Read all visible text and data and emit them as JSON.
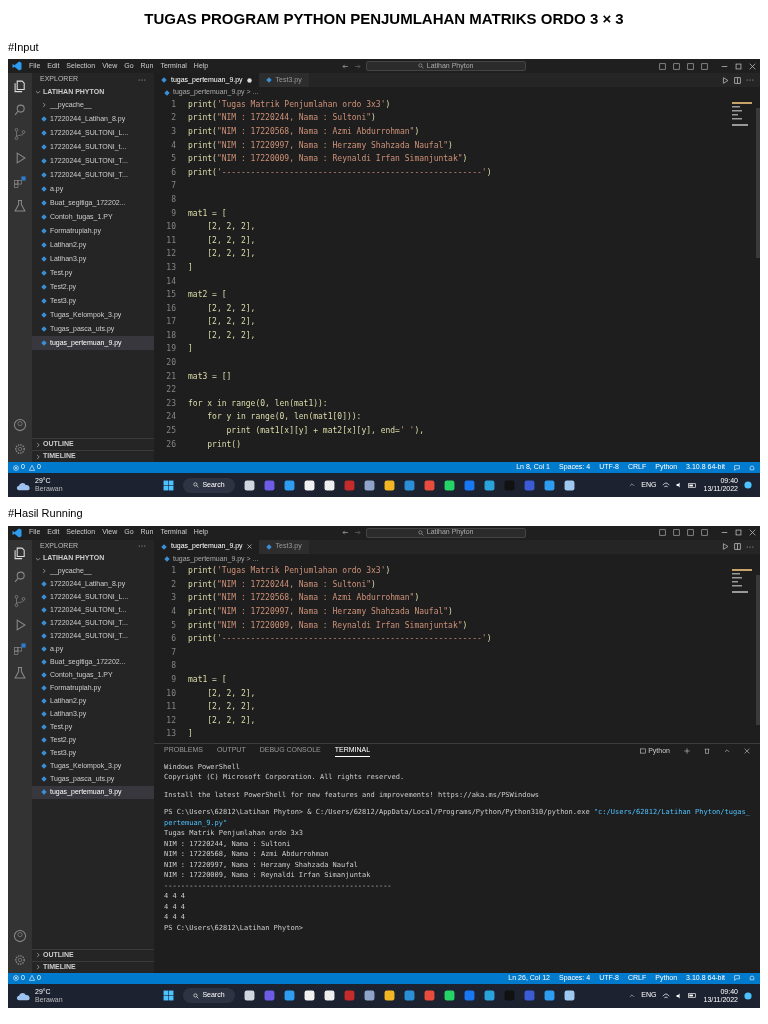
{
  "heading": "TUGAS PROGRAM PYTHON PENJUMLAHAN MATRIKS ORDO 3 × 3",
  "sections": [
    {
      "label": "#Input",
      "screenshot": {
        "menu": [
          "File",
          "Edit",
          "Selection",
          "View",
          "Go",
          "Run",
          "Terminal",
          "Help"
        ],
        "search": "Latihan Phyton",
        "sidebar": {
          "title": "EXPLORER",
          "folder": "LATIHAN PHYTON",
          "items": [
            {
              "label": "__pycache__",
              "kind": "folder",
              "selected": false
            },
            {
              "label": "17220244_Latihan_8.py",
              "kind": "file",
              "selected": false
            },
            {
              "label": "17220244_SULTONI_L...",
              "kind": "file",
              "selected": false
            },
            {
              "label": "17220244_SULTONI_t...",
              "kind": "file",
              "selected": false
            },
            {
              "label": "17220244_SULTONI_T...",
              "kind": "file",
              "selected": false
            },
            {
              "label": "17220244_SULTONI_T...",
              "kind": "file",
              "selected": false
            },
            {
              "label": "a.py",
              "kind": "file",
              "selected": false
            },
            {
              "label": "Buat_segitiga_172202...",
              "kind": "file",
              "selected": false
            },
            {
              "label": "Contoh_tugas_1.PY",
              "kind": "file",
              "selected": false
            },
            {
              "label": "Formatrupiah.py",
              "kind": "file",
              "selected": false
            },
            {
              "label": "Latihan2.py",
              "kind": "file",
              "selected": false
            },
            {
              "label": "Latihan3.py",
              "kind": "file",
              "selected": false
            },
            {
              "label": "Test.py",
              "kind": "file",
              "selected": false
            },
            {
              "label": "Test2.py",
              "kind": "file",
              "selected": false
            },
            {
              "label": "Test3.py",
              "kind": "file",
              "selected": false
            },
            {
              "label": "Tugas_Kelompok_3.py",
              "kind": "file",
              "selected": false
            },
            {
              "label": "Tugas_pasca_uts.py",
              "kind": "file",
              "selected": false
            },
            {
              "label": "tugas_pertemuan_9.py",
              "kind": "file",
              "selected": true
            }
          ],
          "bottom": [
            "OUTLINE",
            "TIMELINE"
          ]
        },
        "tabs": [
          {
            "label": "tugas_pertemuan_9.py",
            "selected": true,
            "modified": true
          },
          {
            "label": "Test3.py",
            "selected": false,
            "modified": false
          }
        ],
        "breadcrumb": "tugas_pertemuan_9.py > ...",
        "code": [
          {
            "n": "1",
            "code": "print('Tugas Matrik Penjumlahan ordo 3x3')"
          },
          {
            "n": "2",
            "code": "print(\"NIM : 17220244, Nama : Sultoni\")"
          },
          {
            "n": "3",
            "code": "print(\"NIM : 17220568, Nama : Azmi Abdurrohman\")"
          },
          {
            "n": "4",
            "code": "print(\"NIM : 17220997, Nama : Herzamy Shahzada Naufal\")"
          },
          {
            "n": "5",
            "code": "print(\"NIM : 17220009, Nama : Reynaldi Irfan Simanjuntak\")"
          },
          {
            "n": "6",
            "code": "print('------------------------------------------------------')"
          },
          {
            "n": "7"
          },
          {
            "n": "8"
          },
          {
            "n": "9",
            "code": "mat1 = ["
          },
          {
            "n": "10",
            "code": "    [2, 2, 2],"
          },
          {
            "n": "11",
            "code": "    [2, 2, 2],"
          },
          {
            "n": "12",
            "code": "    [2, 2, 2],"
          },
          {
            "n": "13",
            "code": "]"
          },
          {
            "n": "14"
          },
          {
            "n": "15",
            "code": "mat2 = ["
          },
          {
            "n": "16",
            "code": "    [2, 2, 2],"
          },
          {
            "n": "17",
            "code": "    [2, 2, 2],"
          },
          {
            "n": "18",
            "code": "    [2, 2, 2],"
          },
          {
            "n": "19",
            "code": "]"
          },
          {
            "n": "20"
          },
          {
            "n": "21",
            "code": "mat3 = []"
          },
          {
            "n": "22"
          },
          {
            "n": "23",
            "code": "for x in range(0, len(mat1)):"
          },
          {
            "n": "24",
            "code": "    for y in range(0, len(mat1[0])):"
          },
          {
            "n": "25",
            "code": "        print (mat1[x][y] + mat2[x][y], end=' '),"
          },
          {
            "n": "26",
            "code": "    print()"
          }
        ],
        "status": {
          "errors": "0",
          "warnings": "0",
          "items": [
            "Ln 8, Col 1",
            "Spaces: 4",
            "UTF-8",
            "CRLF",
            "Python",
            "3.10.8 64-bit"
          ]
        },
        "taskbar": {
          "temperature": "29°C",
          "weather": "Berawan",
          "search": "Search",
          "language": "ENG",
          "time": "09:40",
          "date": "13/11/2022"
        }
      }
    },
    {
      "label": "#Hasil Running",
      "screenshot": {
        "menu": [
          "File",
          "Edit",
          "Selection",
          "View",
          "Go",
          "Run",
          "Terminal",
          "Help"
        ],
        "search": "Latihan Phyton",
        "sidebar": {
          "title": "EXPLORER",
          "folder": "LATIHAN PHYTON",
          "items": [
            {
              "label": "__pycache__",
              "kind": "folder",
              "selected": false
            },
            {
              "label": "17220244_Latihan_8.py",
              "kind": "file",
              "selected": false
            },
            {
              "label": "17220244_SULTONI_L...",
              "kind": "file",
              "selected": false
            },
            {
              "label": "17220244_SULTONI_t...",
              "kind": "file",
              "selected": false
            },
            {
              "label": "17220244_SULTONI_T...",
              "kind": "file",
              "selected": false
            },
            {
              "label": "17220244_SULTONI_T...",
              "kind": "file",
              "selected": false
            },
            {
              "label": "a.py",
              "kind": "file",
              "selected": false
            },
            {
              "label": "Buat_segitiga_172202...",
              "kind": "file",
              "selected": false
            },
            {
              "label": "Contoh_tugas_1.PY",
              "kind": "file",
              "selected": false
            },
            {
              "label": "Formatrupiah.py",
              "kind": "file",
              "selected": false
            },
            {
              "label": "Latihan2.py",
              "kind": "file",
              "selected": false
            },
            {
              "label": "Latihan3.py",
              "kind": "file",
              "selected": false
            },
            {
              "label": "Test.py",
              "kind": "file",
              "selected": false
            },
            {
              "label": "Test2.py",
              "kind": "file",
              "selected": false
            },
            {
              "label": "Test3.py",
              "kind": "file",
              "selected": false
            },
            {
              "label": "Tugas_Kelompok_3.py",
              "kind": "file",
              "selected": false
            },
            {
              "label": "Tugas_pasca_uts.py",
              "kind": "file",
              "selected": false
            },
            {
              "label": "tugas_pertemuan_9.py",
              "kind": "file",
              "selected": true
            }
          ],
          "bottom": [
            "OUTLINE",
            "TIMELINE"
          ]
        },
        "tabs": [
          {
            "label": "tugas_pertemuan_9.py",
            "selected": true,
            "modified": false
          },
          {
            "label": "Test3.py",
            "selected": false,
            "modified": false
          }
        ],
        "breadcrumb": "tugas_pertemuan_9.py > ...",
        "code": [
          {
            "n": "1",
            "code": "print('Tugas Matrik Penjumlahan ordo 3x3')"
          },
          {
            "n": "2",
            "code": "print(\"NIM : 17220244, Nama : Sultoni\")"
          },
          {
            "n": "3",
            "code": "print(\"NIM : 17220568, Nama : Azmi Abdurrohman\")"
          },
          {
            "n": "4",
            "code": "print(\"NIM : 17220997, Nama : Herzamy Shahzada Naufal\")"
          },
          {
            "n": "5",
            "code": "print(\"NIM : 17220009, Nama : Reynaldi Irfan Simanjuntak\")"
          },
          {
            "n": "6",
            "code": "print('------------------------------------------------------')"
          },
          {
            "n": "7"
          },
          {
            "n": "8"
          },
          {
            "n": "9",
            "code": "mat1 = ["
          },
          {
            "n": "10",
            "code": "    [2, 2, 2],"
          },
          {
            "n": "11",
            "code": "    [2, 2, 2],"
          },
          {
            "n": "12",
            "code": "    [2, 2, 2],"
          },
          {
            "n": "13",
            "code": "]"
          }
        ],
        "panel": {
          "tabs": [
            {
              "label": "PROBLEMS",
              "selected": false
            },
            {
              "label": "OUTPUT",
              "selected": false
            },
            {
              "label": "DEBUG CONSOLE",
              "selected": false
            },
            {
              "label": "TERMINAL",
              "selected": true
            }
          ],
          "shell": "Python",
          "blocks": [
            [
              "Windows PowerShell",
              "Copyright (C) Microsoft Corporation. All rights reserved."
            ],
            [
              "Install the latest PowerShell for new features and improvements! https://aka.ms/PSWindows"
            ],
            [
              "PS C:\\Users\\62812\\Latihan Phyton> & C:/Users/62812/AppData/Local/Programs/Python/Python310/python.exe \"c:/Users/62812/Latihan Phyton/tugas_pertemuan_9.py\"",
              "Tugas Matrik Penjumlahan ordo 3x3",
              "NIM : 17220244, Nama : Sultoni",
              "NIM : 17220568, Nama : Azmi Abdurrohman",
              "NIM : 17220997, Nama : Herzamy Shahzada Naufal",
              "NIM : 17220009, Nama : Reynaldi Irfan Simanjuntak",
              "------------------------------------------------------",
              "4 4 4",
              "4 4 4",
              "4 4 4",
              "PS C:\\Users\\62812\\Latihan Phyton>"
            ]
          ]
        },
        "status": {
          "errors": "0",
          "warnings": "0",
          "items": [
            "Ln 26, Col 12",
            "Spaces: 4",
            "UTF-8",
            "CRLF",
            "Python",
            "3.10.8 64-bit"
          ]
        },
        "taskbar": {
          "temperature": "29°C",
          "weather": "Berawan",
          "search": "Search",
          "language": "ENG",
          "time": "09:40",
          "date": "13/11/2022"
        }
      }
    }
  ]
}
